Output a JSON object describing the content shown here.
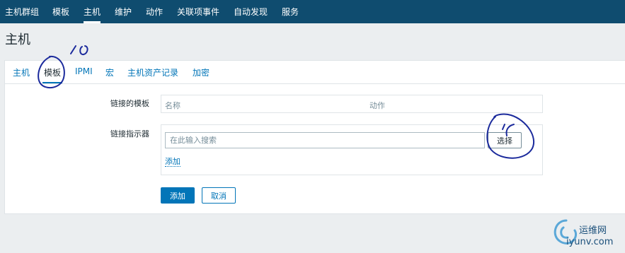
{
  "topnav": {
    "items": [
      {
        "label": "主机群组"
      },
      {
        "label": "模板"
      },
      {
        "label": "主机",
        "active": true
      },
      {
        "label": "维护"
      },
      {
        "label": "动作"
      },
      {
        "label": "关联项事件"
      },
      {
        "label": "自动发现"
      },
      {
        "label": "服务"
      }
    ]
  },
  "page": {
    "title": "主机"
  },
  "tabs": [
    {
      "label": "主机"
    },
    {
      "label": "模板",
      "active": true
    },
    {
      "label": "IPMI"
    },
    {
      "label": "宏"
    },
    {
      "label": "主机资产记录"
    },
    {
      "label": "加密"
    }
  ],
  "form": {
    "linked_templates_label": "链接的模板",
    "linked_templates_columns": [
      "名称",
      "动作"
    ],
    "link_indicator_label": "链接指示器",
    "search_placeholder": "在此输入搜索",
    "select_button": "选择",
    "add_link": "添加",
    "submit_button": "添加",
    "cancel_button": "取消"
  },
  "annotations": {
    "tab_mark": "10",
    "button_mark": "11"
  },
  "watermark": {
    "cn": "运维网",
    "domain": "iyunv.com"
  },
  "colors": {
    "topnav_bg": "#0f4c6f",
    "link": "#0275b8",
    "page_bg": "#ebeef0",
    "annotation_ink": "#1b2a9c"
  }
}
